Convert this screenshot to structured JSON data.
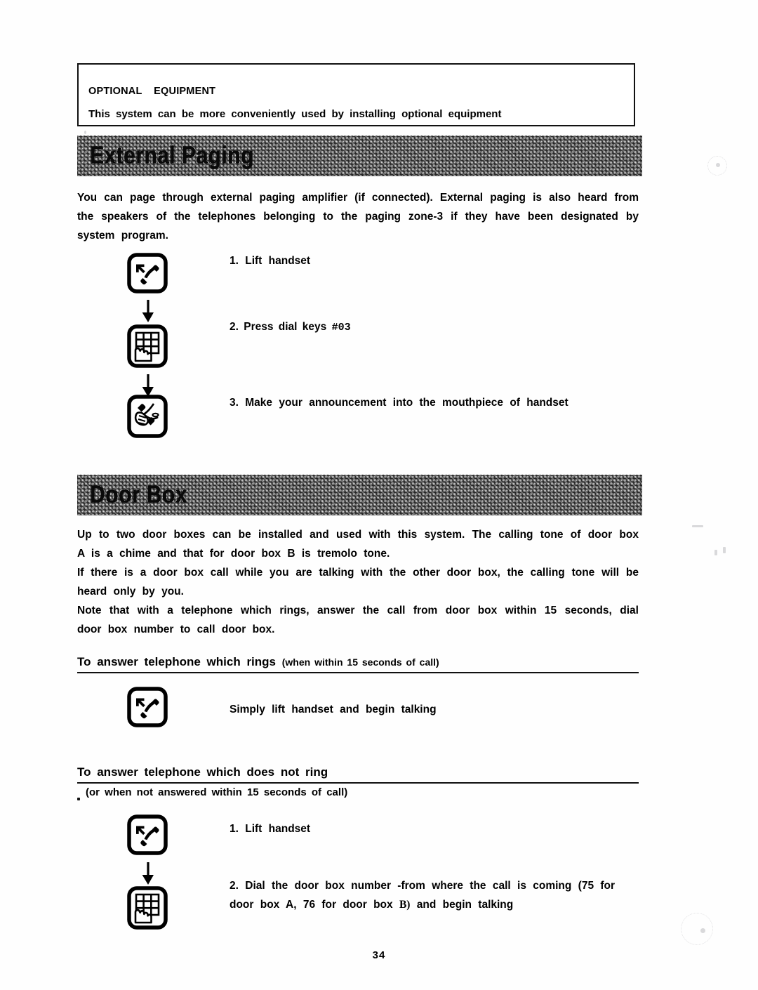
{
  "document": {
    "page_number": "34",
    "optional_box": {
      "title": "OPTIONAL    EQUIPMENT",
      "subtitle": "This system can be more conveniently used by installing optional equipment"
    },
    "sections": [
      {
        "banner": "External Paging",
        "paragraphs": [
          "You can page through external paging amplifier (if connected). External paging is also heard from the speakers of the telephones belonging to the paging zone-3 if they have been designated by system program."
        ],
        "steps": [
          {
            "icon": "lift-handset-icon",
            "number": "1.",
            "text": "Lift handset"
          },
          {
            "icon": "dial-keypad-icon",
            "number": "2.",
            "text": "Press dial keys",
            "code": "#03"
          },
          {
            "icon": "announce-handset-icon",
            "number": "3.",
            "text": "Make your announcement into the mouthpiece of handset"
          }
        ]
      },
      {
        "banner": "Door Box",
        "paragraphs": [
          "Up to two door boxes can be installed and used with this system. The calling tone of door box A is a chime and that for door box B is tremolo tone.",
          "If there is a door box call while you are talking with the other door box, the calling tone will be heard only by you.",
          "Note that with a telephone which rings, answer the call from door box within 15 seconds, dial door box number to call door box."
        ],
        "subsections": [
          {
            "heading": "To answer telephone which rings",
            "heading_note": "(when within 15 seconds of call)",
            "steps": [
              {
                "icon": "lift-handset-icon",
                "number": "",
                "text": "Simply lift handset and begin talking"
              }
            ]
          },
          {
            "heading": "To answer telephone which does not ring",
            "heading_note": "(or when not answered within 15 seconds of call)",
            "steps": [
              {
                "icon": "lift-handset-icon",
                "number": "1.",
                "text": "Lift handset"
              },
              {
                "icon": "dial-keypad-icon",
                "number": "2.",
                "text_part1": "Dial the door box number -from where the call is coming (75 for door box A, 76 for door box",
                "text_boxb": "B)",
                "text_part2": "and begin talking"
              }
            ]
          }
        ]
      }
    ]
  }
}
